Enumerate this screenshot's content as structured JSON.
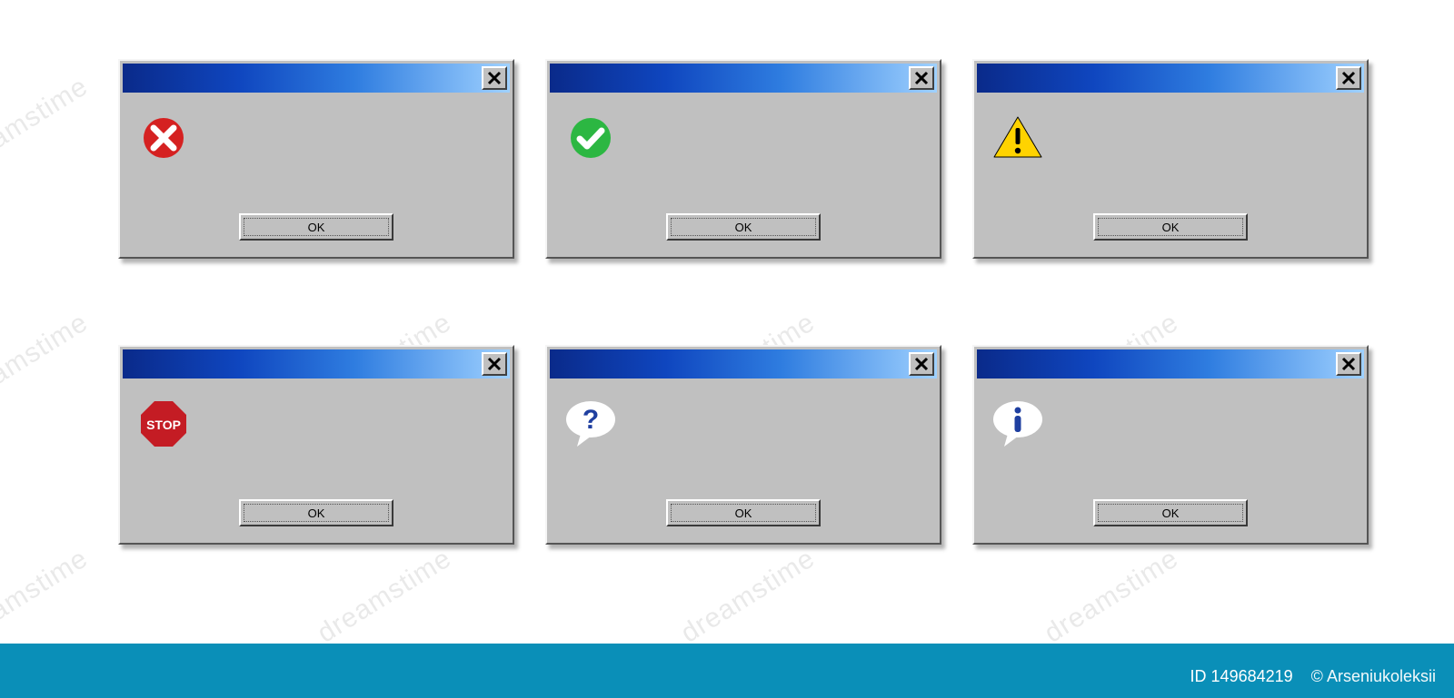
{
  "colors": {
    "titlebar_gradient_from": "#0a2a8a",
    "titlebar_gradient_to": "#9fd1ff",
    "dialog_face": "#c0c0c0",
    "error_red": "#d52121",
    "success_green": "#2cb742",
    "warning_yellow": "#ffd300",
    "stop_red": "#c41c24",
    "info_blue": "#1f3fa0",
    "bottom_bar": "#0a8fb8"
  },
  "dialogs": [
    {
      "id": "error",
      "icon": "error-cross-icon",
      "ok_label": "OK",
      "close_label": "×"
    },
    {
      "id": "success",
      "icon": "success-check-icon",
      "ok_label": "OK",
      "close_label": "×"
    },
    {
      "id": "warning",
      "icon": "warning-triangle-icon",
      "ok_label": "OK",
      "close_label": "×"
    },
    {
      "id": "stop",
      "icon": "stop-sign-icon",
      "ok_label": "OK",
      "close_label": "×",
      "stop_text": "STOP"
    },
    {
      "id": "question",
      "icon": "question-bubble-icon",
      "ok_label": "OK",
      "close_label": "×"
    },
    {
      "id": "info",
      "icon": "info-bubble-icon",
      "ok_label": "OK",
      "close_label": "×"
    }
  ],
  "watermark": {
    "text": "dreamstime"
  },
  "credit": {
    "id_label": "ID 149684219",
    "copyright": "© Arseniukoleksii"
  }
}
